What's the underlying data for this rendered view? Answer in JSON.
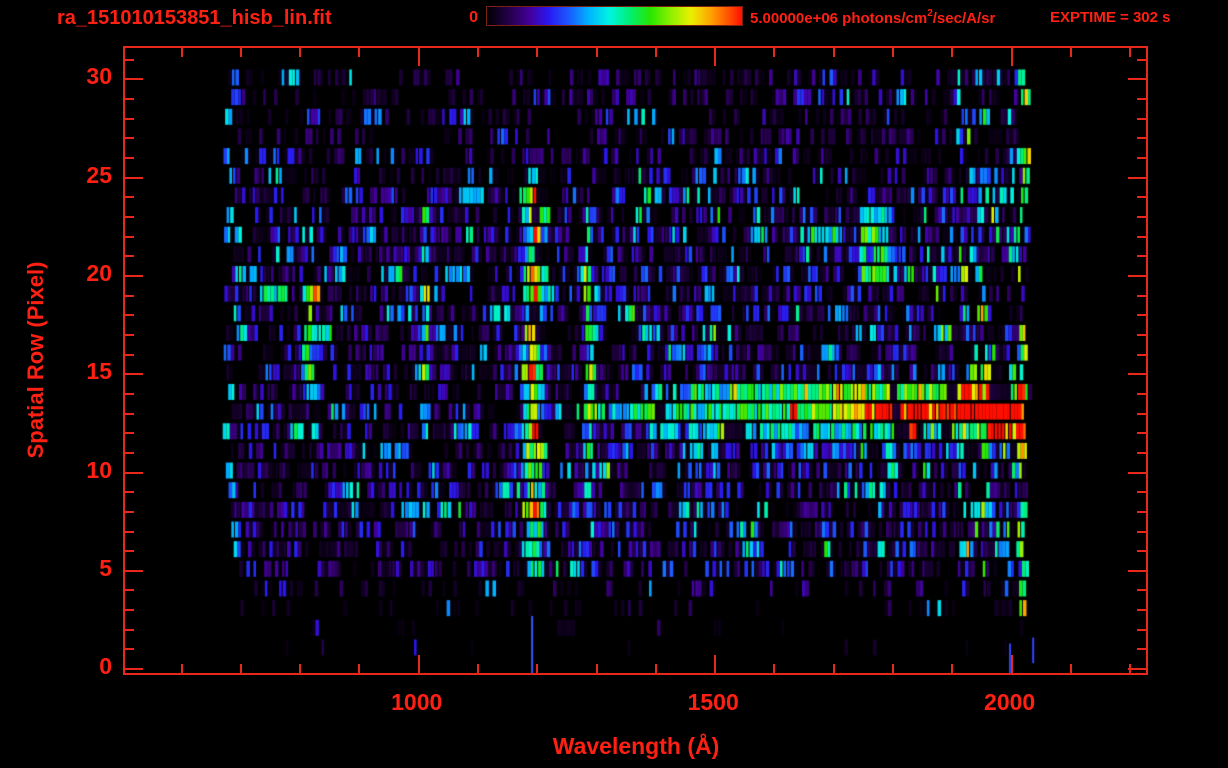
{
  "header": {
    "title": "ra_151010153851_hisb_lin.fit",
    "colorbar_min_label": "0",
    "units_prefix": "5.00000e+06 photons/cm",
    "units_sup": "2",
    "units_suffix": "/sec/A/sr",
    "exptime_label": "EXPTIME = 302 s"
  },
  "colors": {
    "background": "#000000",
    "axis": "#e8281a",
    "text": "#ff2014",
    "colorbar_border": "#7a2010",
    "colormap_stops": [
      [
        0.0,
        "#000000"
      ],
      [
        0.09,
        "#26004d"
      ],
      [
        0.17,
        "#44009e"
      ],
      [
        0.24,
        "#2b16f0"
      ],
      [
        0.32,
        "#1b59ff"
      ],
      [
        0.4,
        "#00b4ff"
      ],
      [
        0.48,
        "#00f5e1"
      ],
      [
        0.56,
        "#00ef74"
      ],
      [
        0.64,
        "#27e600"
      ],
      [
        0.72,
        "#8cf000"
      ],
      [
        0.8,
        "#eaf000"
      ],
      [
        0.88,
        "#ffa000"
      ],
      [
        0.95,
        "#ff4d00"
      ],
      [
        1.0,
        "#ff0f00"
      ]
    ]
  },
  "chart_data": {
    "type": "heatmap",
    "title": "ra_151010153851_hisb_lin.fit",
    "xlabel": "Wavelength (Å)",
    "ylabel": "Spatial Row (Pixel)",
    "x_range": [
      508,
      2230
    ],
    "y_range": [
      -0.3,
      31.5
    ],
    "x_major_ticks": [
      1000,
      1500,
      2000
    ],
    "x_minor_step": 100,
    "x_minor_range": [
      600,
      2200
    ],
    "y_major_ticks": [
      0,
      5,
      10,
      15,
      20,
      25,
      30
    ],
    "y_minor_step": 1,
    "colorbar": {
      "min": 0,
      "max": 5000000,
      "units": "photons/cm2/sec/A/sr"
    },
    "exposure_seconds": 302,
    "grid": false,
    "data_extent": {
      "wavelength": [
        672,
        2034
      ],
      "rows": [
        1,
        30
      ]
    },
    "features": {
      "noise_rows": [
        {
          "rows": [
            25,
            30
          ],
          "base": 0.085,
          "gap_prob": 0.52
        },
        {
          "rows": [
            5,
            24
          ],
          "base": 0.15,
          "gap_prob": 0.33
        },
        {
          "rows": [
            4,
            4
          ],
          "base": 0.06,
          "gap_prob": 0.72
        },
        {
          "rows": [
            3,
            3
          ],
          "base": 0.045,
          "gap_prob": 0.85
        },
        {
          "rows": [
            1,
            2
          ],
          "base": 0.02,
          "gap_prob": 0.975
        }
      ],
      "emission_lines": [
        {
          "name": "arc-810",
          "center": 812,
          "sigma": 8,
          "rows": [
            13,
            19.5
          ],
          "amp": 0.52,
          "curve": 1.7,
          "curve_row": 16.2
        },
        {
          "name": "line-1012",
          "center": 1012,
          "sigma": 5.5,
          "rows": [
            11.5,
            23.2
          ],
          "amp": 0.42
        },
        {
          "name": "lyman-alpha",
          "center": 1195,
          "sigma": 11,
          "rows": [
            4.8,
            24.2
          ],
          "amp": 0.7
        },
        {
          "name": "line-1289",
          "center": 1289,
          "sigma": 6.5,
          "rows": [
            7,
            23.5
          ],
          "amp": 0.34
        }
      ],
      "continuum_rows": [
        {
          "row": 13,
          "profile": [
            [
              1230,
              0.25
            ],
            [
              1450,
              0.38
            ],
            [
              1612,
              0.5
            ],
            [
              1700,
              0.6
            ],
            [
              1765,
              0.85
            ],
            [
              1810,
              0.93
            ],
            [
              2029,
              0.95
            ]
          ]
        },
        {
          "row": 14,
          "profile": [
            [
              1380,
              0.22
            ],
            [
              1550,
              0.4
            ],
            [
              1700,
              0.52
            ],
            [
              1860,
              0.58
            ],
            [
              2029,
              0.5
            ]
          ]
        },
        {
          "row": 12,
          "profile": [
            [
              1400,
              0.22
            ],
            [
              1900,
              0.4
            ],
            [
              1995,
              0.55
            ],
            [
              2029,
              0.8
            ]
          ]
        },
        {
          "row": 11,
          "profile": [
            [
              1520,
              0.1
            ],
            [
              1990,
              0.2
            ],
            [
              2029,
              0.75
            ]
          ]
        }
      ],
      "patches": [
        {
          "name": "cyan-patch",
          "x": [
            1745,
            1795
          ],
          "rows": [
            19.5,
            23.2
          ],
          "amp": 0.3
        }
      ],
      "right_band": {
        "from": 1910,
        "amp": 0.15
      },
      "stray_marks": [
        {
          "wavelength": 1193,
          "rows": [
            -0.3,
            2.6
          ],
          "color": "#3a57ff"
        },
        {
          "wavelength": 1999,
          "rows": [
            -0.3,
            1.2
          ],
          "color": "#3344ff"
        },
        {
          "wavelength": 2038,
          "rows": [
            0.2,
            1.5
          ],
          "color": "#3344ff"
        }
      ]
    }
  }
}
